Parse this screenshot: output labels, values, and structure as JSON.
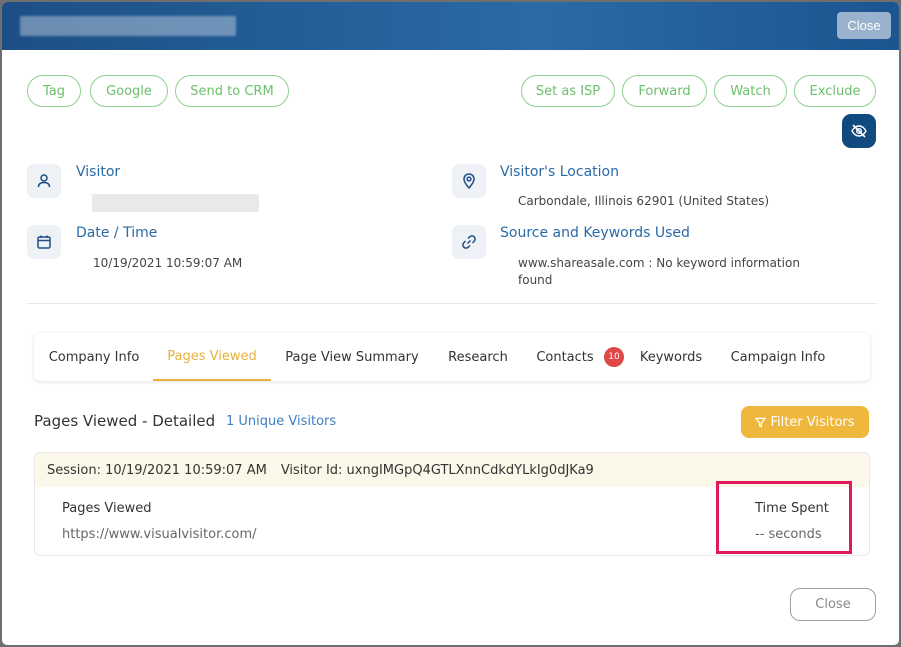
{
  "header": {
    "title_redacted": true,
    "close_label": "Close"
  },
  "actions_left": [
    "Tag",
    "Google",
    "Send to CRM"
  ],
  "actions_right": [
    "Set as ISP",
    "Forward",
    "Watch",
    "Exclude"
  ],
  "visitor": {
    "title": "Visitor",
    "value_redacted": true
  },
  "location": {
    "title": "Visitor's Location",
    "value": "Carbondale, Illinois 62901 (United States)"
  },
  "datetime": {
    "title": "Date / Time",
    "value": "10/19/2021 10:59:07 AM"
  },
  "source": {
    "title": "Source and Keywords Used",
    "value_line1": "www.shareasale.com : No keyword information",
    "value_line2": "found"
  },
  "tabs": {
    "company_info": "Company Info",
    "pages_viewed": "Pages Viewed",
    "page_view_summary": "Page View Summary",
    "research": "Research",
    "contacts": "Contacts",
    "contacts_badge": "10",
    "keywords": "Keywords",
    "campaign_info": "Campaign Info",
    "active": "Pages Viewed"
  },
  "section": {
    "title": "Pages Viewed - Detailed",
    "unique_visitors": "1 Unique Visitors",
    "filter_label": "Filter Visitors"
  },
  "session": {
    "session_text": "Session: 10/19/2021 10:59:07 AM",
    "visitor_id_text": "Visitor Id: uxngIMGpQ4GTLXnnCdkdYLkIg0dJKa9",
    "pages_label": "Pages Viewed",
    "page_url": "https://www.visualvisitor.com/",
    "time_label": "Time Spent",
    "time_value": "-- seconds"
  },
  "footer": {
    "close_label": "Close"
  },
  "colors": {
    "header": "#1d4f86",
    "pill_green": "#6cbf6c",
    "accent_gold": "#e7b03d",
    "highlight": "#e0195c"
  }
}
